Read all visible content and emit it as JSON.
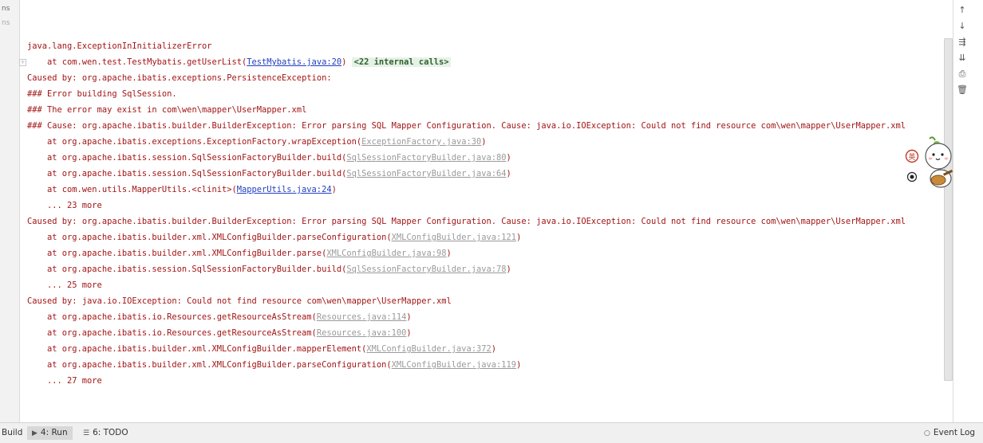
{
  "left_gutter": {
    "label_1": "ns",
    "label_2": "ns"
  },
  "console_lines": [
    {
      "kind": "error",
      "text": "java.lang.ExceptionInInitializerError"
    },
    {
      "kind": "frame",
      "prefix": "at com.wen.test.TestMybatis.getUserList(",
      "link": "TestMybatis.java:20",
      "link_type": "user",
      "suffix": ") ",
      "badge": "<22 internal calls>",
      "fold": true
    },
    {
      "kind": "error",
      "text": "Caused by: org.apache.ibatis.exceptions.PersistenceException: "
    },
    {
      "kind": "error",
      "text": "### Error building SqlSession."
    },
    {
      "kind": "error",
      "text": "### The error may exist in com\\wen\\mapper\\UserMapper.xml"
    },
    {
      "kind": "error",
      "text": "### Cause: org.apache.ibatis.builder.BuilderException: Error parsing SQL Mapper Configuration. Cause: java.io.IOException: Could not find resource com\\wen\\mapper\\UserMapper.xml"
    },
    {
      "kind": "frame",
      "prefix": "at org.apache.ibatis.exceptions.ExceptionFactory.wrapException(",
      "link": "ExceptionFactory.java:30",
      "link_type": "lib",
      "suffix": ")"
    },
    {
      "kind": "frame",
      "prefix": "at org.apache.ibatis.session.SqlSessionFactoryBuilder.build(",
      "link": "SqlSessionFactoryBuilder.java:80",
      "link_type": "lib",
      "suffix": ")"
    },
    {
      "kind": "frame",
      "prefix": "at org.apache.ibatis.session.SqlSessionFactoryBuilder.build(",
      "link": "SqlSessionFactoryBuilder.java:64",
      "link_type": "lib",
      "suffix": ")"
    },
    {
      "kind": "frame",
      "prefix": "at com.wen.utils.MapperUtils.<clinit>(",
      "link": "MapperUtils.java:24",
      "link_type": "user",
      "suffix": ")"
    },
    {
      "kind": "frame",
      "prefix": "... 23 more"
    },
    {
      "kind": "error",
      "text": "Caused by: org.apache.ibatis.builder.BuilderException: Error parsing SQL Mapper Configuration. Cause: java.io.IOException: Could not find resource com\\wen\\mapper\\UserMapper.xml"
    },
    {
      "kind": "frame",
      "prefix": "at org.apache.ibatis.builder.xml.XMLConfigBuilder.parseConfiguration(",
      "link": "XMLConfigBuilder.java:121",
      "link_type": "lib",
      "suffix": ")"
    },
    {
      "kind": "frame",
      "prefix": "at org.apache.ibatis.builder.xml.XMLConfigBuilder.parse(",
      "link": "XMLConfigBuilder.java:98",
      "link_type": "lib",
      "suffix": ")"
    },
    {
      "kind": "frame",
      "prefix": "at org.apache.ibatis.session.SqlSessionFactoryBuilder.build(",
      "link": "SqlSessionFactoryBuilder.java:78",
      "link_type": "lib",
      "suffix": ")"
    },
    {
      "kind": "frame",
      "prefix": "... 25 more"
    },
    {
      "kind": "error",
      "text": "Caused by: java.io.IOException: Could not find resource com\\wen\\mapper\\UserMapper.xml"
    },
    {
      "kind": "frame",
      "prefix": "at org.apache.ibatis.io.Resources.getResourceAsStream(",
      "link": "Resources.java:114",
      "link_type": "lib",
      "suffix": ")"
    },
    {
      "kind": "frame",
      "prefix": "at org.apache.ibatis.io.Resources.getResourceAsStream(",
      "link": "Resources.java:100",
      "link_type": "lib",
      "suffix": ")"
    },
    {
      "kind": "frame",
      "prefix": "at org.apache.ibatis.builder.xml.XMLConfigBuilder.mapperElement(",
      "link": "XMLConfigBuilder.java:372",
      "link_type": "lib",
      "suffix": ")"
    },
    {
      "kind": "frame",
      "prefix": "at org.apache.ibatis.builder.xml.XMLConfigBuilder.parseConfiguration(",
      "link": "XMLConfigBuilder.java:119",
      "link_type": "lib",
      "suffix": ")"
    },
    {
      "kind": "frame",
      "prefix": "... 27 more"
    }
  ],
  "right_toolbar": [
    {
      "icon": "arrow-up-icon",
      "glyph": "↑"
    },
    {
      "icon": "arrow-down-icon",
      "glyph": "↓"
    },
    {
      "icon": "soft-wrap-icon",
      "glyph": "⇶"
    },
    {
      "icon": "scroll-to-end-icon",
      "glyph": "⇊"
    },
    {
      "icon": "print-icon",
      "glyph": "⎙"
    },
    {
      "icon": "trash-icon",
      "glyph": "🗑"
    }
  ],
  "mascot": {
    "badge_text": "英"
  },
  "status_bar": {
    "build_label": "Build",
    "run_label": "4: Run",
    "todo_label": "6: TODO",
    "event_log_label": "Event Log"
  },
  "colors": {
    "error_text": "#a31515",
    "user_link": "#2040c0",
    "library_link": "#9a9a9a",
    "internal_badge_bg": "#e6f2e6"
  }
}
